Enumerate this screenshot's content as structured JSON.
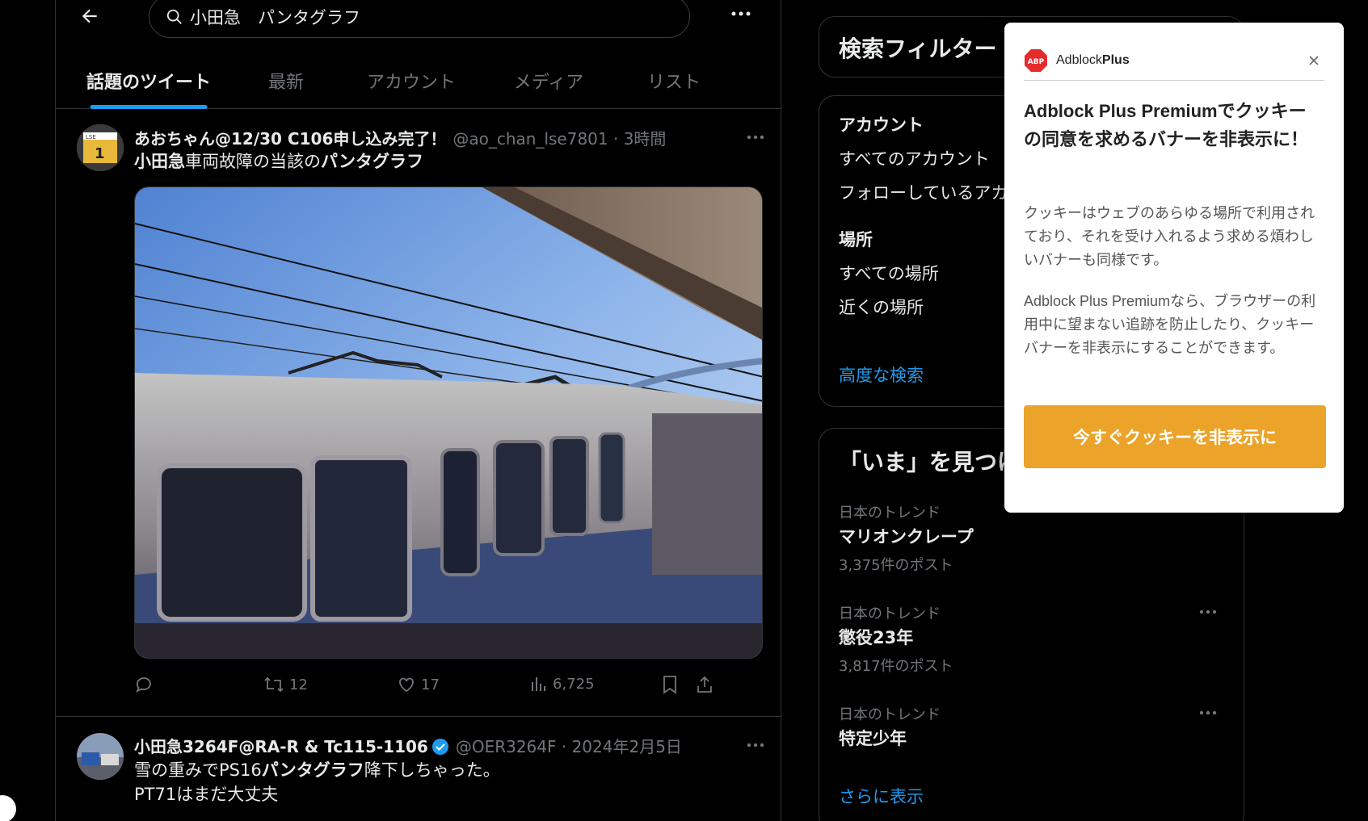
{
  "search": {
    "query": "小田急　パンタグラフ"
  },
  "tabs": [
    {
      "label": "話題のツイート",
      "active": true
    },
    {
      "label": "最新",
      "active": false
    },
    {
      "label": "アカウント",
      "active": false
    },
    {
      "label": "メディア",
      "active": false
    },
    {
      "label": "リスト",
      "active": false
    }
  ],
  "tweets": [
    {
      "name": "あおちゃん@12/30 C106申し込み完了！",
      "handle": "@ao_chan_lse7801 · 3時間",
      "text_pre": "小田急",
      "text_mid": "車両故障の当該の",
      "text_bold": "パンタグラフ",
      "avatar_label": "LSE 1",
      "replies": "",
      "retweets": "12",
      "likes": "17",
      "views": "6,725"
    },
    {
      "name": "小田急3264F@RA-R & Tc115-1106",
      "handle": "@OER3264F · 2024年2月5日",
      "line1_pre": "雪の重みでPS16",
      "line1_bold": "パンタグラフ",
      "line1_post": "降下しちゃった。",
      "line2": "PT71はまだ大丈夫"
    }
  ],
  "filters": {
    "title": "検索フィルター",
    "account_label": "アカウント",
    "account_opts": [
      "すべてのアカウント",
      "フォローしているアカウント"
    ],
    "location_label": "場所",
    "location_opts": [
      "すべての場所",
      "近くの場所"
    ],
    "advanced": "高度な検索"
  },
  "explore": {
    "title": "「いま」を見つけよう",
    "trends": [
      {
        "category": "日本のトレンド",
        "name": "マリオンクレープ",
        "count": "3,375件のポスト"
      },
      {
        "category": "日本のトレンド",
        "name": "懲役23年",
        "count": "3,817件のポスト"
      },
      {
        "category": "日本のトレンド",
        "name": "特定少年",
        "count": ""
      }
    ],
    "show_more": "さらに表示"
  },
  "adblock": {
    "brand_light": "Adblock",
    "brand_bold": "Plus",
    "logo_text": "ABP",
    "title": "Adblock Plus Premiumでクッキーの同意を求めるバナーを非表示に！",
    "p1": "クッキーはウェブのあらゆる場所で利用されており、それを受け入れるよう求める煩わしいバナーも同様です。",
    "p2": "Adblock Plus Premiumなら、ブラウザーの利用中に望まない追跡を防止したり、クッキーバナーを非表示にすることができます。",
    "button": "今すぐクッキーを非表示に"
  },
  "colors": {
    "accent": "#1d9bf0",
    "abp_button": "#eba429",
    "abp_logo": "#e52b2b"
  }
}
